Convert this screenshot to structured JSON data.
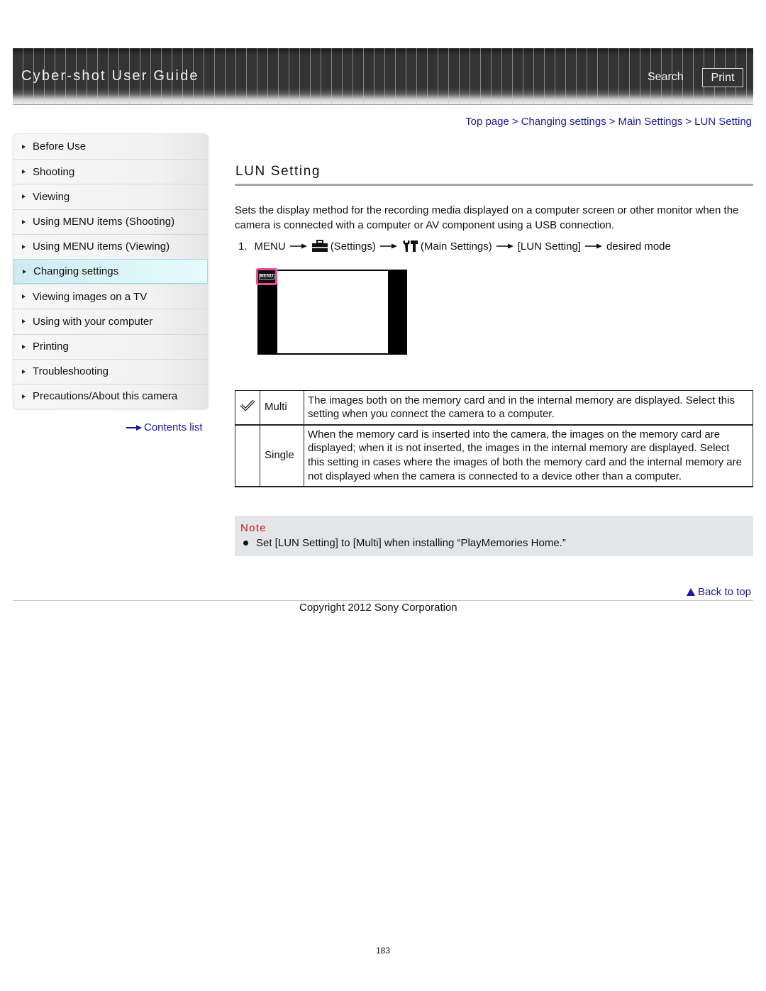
{
  "header": {
    "title": "Cyber-shot User Guide",
    "search_label": "Search",
    "print_label": "Print"
  },
  "breadcrumb": {
    "items": [
      "Top page",
      "Changing settings",
      "Main Settings",
      "LUN Setting"
    ],
    "separator": ">"
  },
  "sidebar": {
    "items": [
      {
        "label": "Before Use",
        "active": false
      },
      {
        "label": "Shooting",
        "active": false
      },
      {
        "label": "Viewing",
        "active": false
      },
      {
        "label": "Using MENU items (Shooting)",
        "active": false
      },
      {
        "label": "Using MENU items (Viewing)",
        "active": false
      },
      {
        "label": "Changing settings",
        "active": true
      },
      {
        "label": "Viewing images on a TV",
        "active": false
      },
      {
        "label": "Using with your computer",
        "active": false
      },
      {
        "label": "Printing",
        "active": false
      },
      {
        "label": "Troubleshooting",
        "active": false
      },
      {
        "label": "Precautions/About this camera",
        "active": false
      }
    ],
    "contents_list_label": "Contents list"
  },
  "main": {
    "title": "LUN Setting",
    "intro": "Sets the display method for the recording media displayed on a computer screen or other monitor when the camera is connected with a computer or AV component using a USB connection.",
    "step": {
      "number": "1.",
      "menu": "MENU",
      "settings": "(Settings)",
      "main_settings": "(Main Settings)",
      "lun_setting": "[LUN Setting]",
      "desired_mode": "desired mode"
    },
    "illustration": {
      "menu_button_label": "MENU"
    },
    "modes": [
      {
        "icon": "checkmark-icon",
        "name": "Multi",
        "description": "The images both on the memory card and in the internal memory are displayed. Select this setting when you connect the camera to a computer."
      },
      {
        "icon": "",
        "name": "Single",
        "description": "When the memory card is inserted into the camera, the images on the memory card are displayed; when it is not inserted, the images in the internal memory are displayed. Select this setting in cases where the images of both the memory card and the internal memory are not displayed when the camera is connected to a device other than a computer."
      }
    ],
    "note": {
      "title": "Note",
      "items": [
        "Set [LUN Setting] to [Multi] when installing “PlayMemories Home.”"
      ]
    }
  },
  "footer": {
    "back_to_top_label": "Back to top",
    "copyright": "Copyright 2012 Sony Corporation",
    "page_number": "183"
  },
  "colors": {
    "link": "#1a1a9a",
    "note_title": "#cc1414",
    "note_background": "#e4e5e8",
    "active_sidebar": "#dcf5f8",
    "highlight_frame": "#f2479a"
  }
}
